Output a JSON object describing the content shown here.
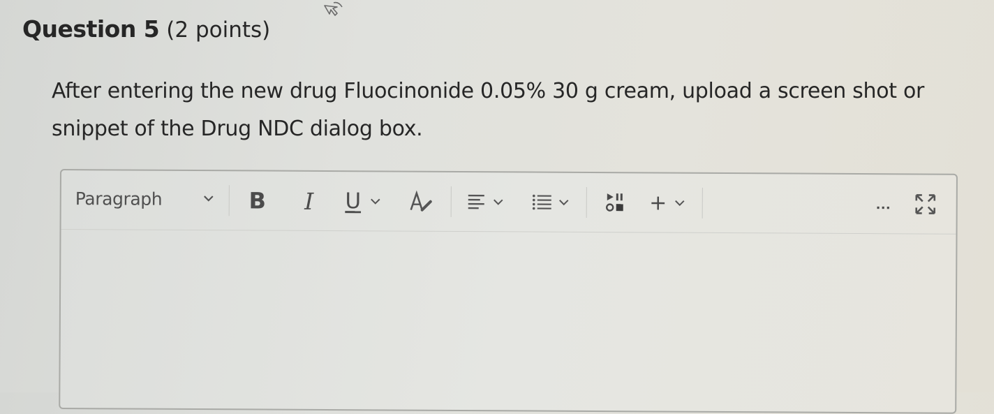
{
  "question": {
    "title": "Question 5",
    "points": "(2 points)",
    "prompt": "After entering the new drug Fluocinonide 0.05% 30 g cream, upload a screen shot or snippet of the Drug NDC dialog box."
  },
  "editor": {
    "block_format_value": "Paragraph",
    "toolbar": {
      "bold_label": "B",
      "italic_label": "I",
      "underline_label": "U",
      "insert_label": "+",
      "more_label": "..."
    },
    "content": ""
  },
  "icons": {
    "cursor": "hand-cursor-icon",
    "dropdown": "chevron-down-icon",
    "text_color": "text-color-icon",
    "align": "align-left-icon",
    "list": "bullet-list-icon",
    "media": "media-icon",
    "fullscreen": "fullscreen-icon"
  }
}
